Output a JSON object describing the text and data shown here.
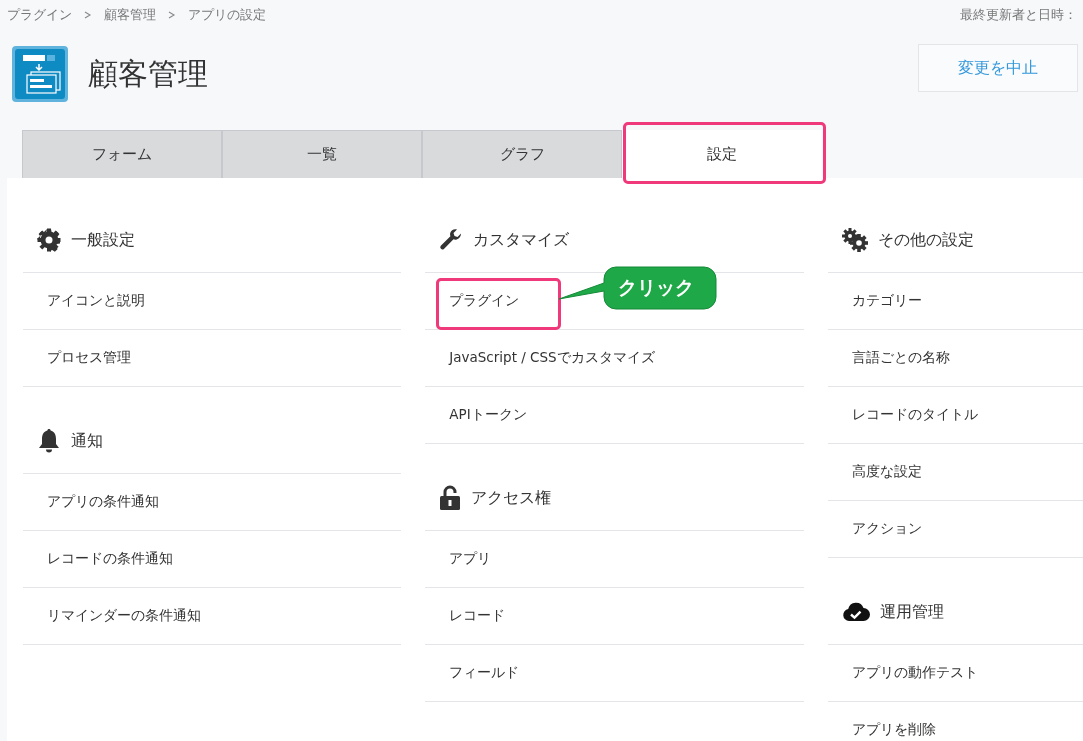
{
  "breadcrumb": [
    "プラグイン",
    "顧客管理",
    "アプリの設定"
  ],
  "last_updated_label": "最終更新者と日時：",
  "app_title": "顧客管理",
  "cancel_button": "変更を中止",
  "tabs": [
    {
      "label": "フォーム",
      "selected": false,
      "highlighted": false
    },
    {
      "label": "一覧",
      "selected": false,
      "highlighted": false
    },
    {
      "label": "グラフ",
      "selected": false,
      "highlighted": false
    },
    {
      "label": "設定",
      "selected": true,
      "highlighted": true
    }
  ],
  "columns": [
    {
      "sections": [
        {
          "title": "一般設定",
          "items": [
            {
              "label": "アイコンと説明",
              "highlighted": false
            },
            {
              "label": "プロセス管理",
              "highlighted": false
            }
          ]
        },
        {
          "title": "通知",
          "items": [
            {
              "label": "アプリの条件通知",
              "highlighted": false
            },
            {
              "label": "レコードの条件通知",
              "highlighted": false
            },
            {
              "label": "リマインダーの条件通知",
              "highlighted": false
            }
          ]
        }
      ]
    },
    {
      "sections": [
        {
          "title": "カスタマイズ",
          "items": [
            {
              "label": "プラグイン",
              "highlighted": true,
              "callout": "クリック"
            },
            {
              "label": "JavaScript / CSSでカスタマイズ",
              "highlighted": false
            },
            {
              "label": "APIトークン",
              "highlighted": false
            }
          ]
        },
        {
          "title": "アクセス権",
          "items": [
            {
              "label": "アプリ",
              "highlighted": false
            },
            {
              "label": "レコード",
              "highlighted": false
            },
            {
              "label": "フィールド",
              "highlighted": false
            }
          ]
        }
      ]
    },
    {
      "sections": [
        {
          "title": "その他の設定",
          "items": [
            {
              "label": "カテゴリー",
              "highlighted": false
            },
            {
              "label": "言語ごとの名称",
              "highlighted": false
            },
            {
              "label": "レコードのタイトル",
              "highlighted": false
            },
            {
              "label": "高度な設定",
              "highlighted": false
            },
            {
              "label": "アクション",
              "highlighted": false
            }
          ]
        },
        {
          "title": "運用管理",
          "items": [
            {
              "label": "アプリの動作テスト",
              "highlighted": false
            },
            {
              "label": "アプリを削除",
              "highlighted": false
            }
          ]
        }
      ]
    }
  ]
}
